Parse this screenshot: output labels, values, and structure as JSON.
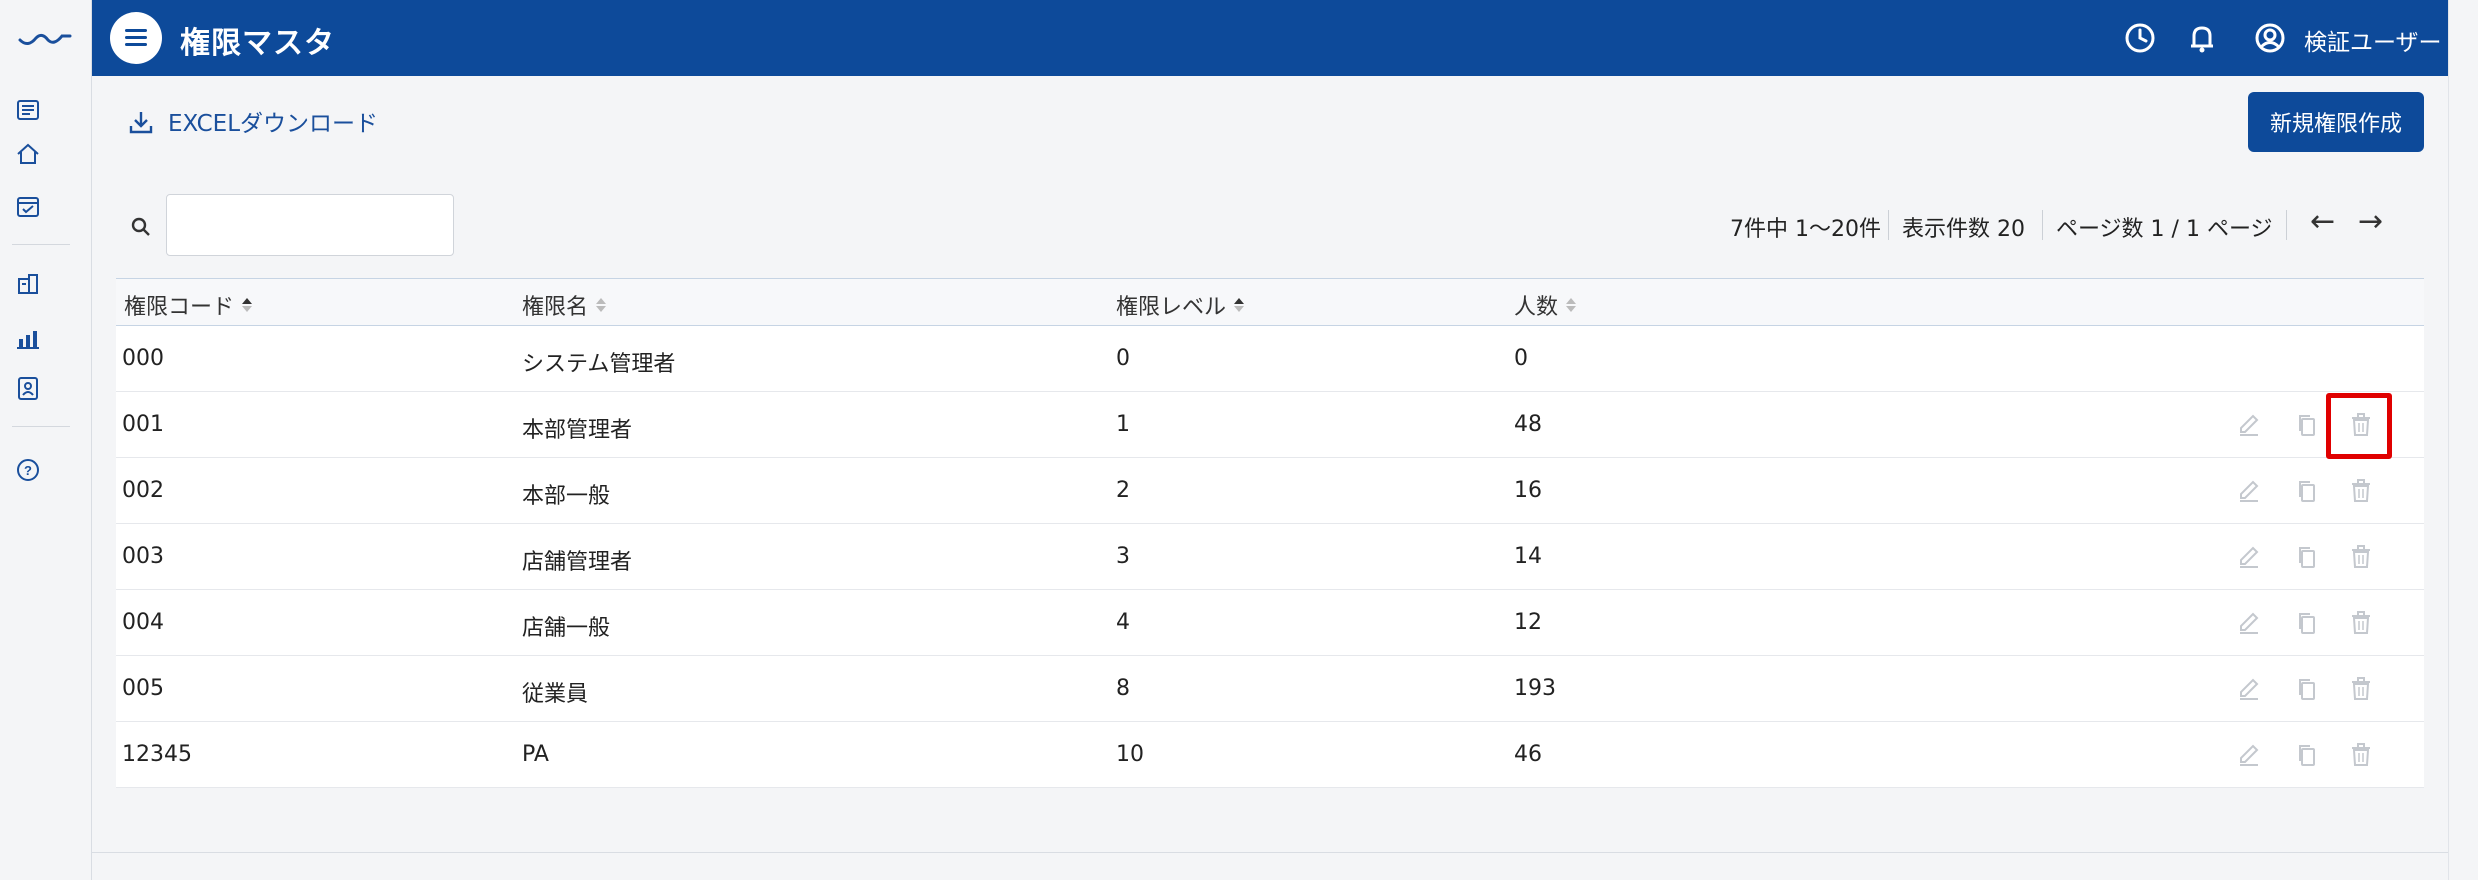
{
  "header": {
    "title": "権限マスタ",
    "user_name": "検証ユーザー",
    "icons": [
      "menu-icon",
      "clock-icon",
      "bell-icon",
      "user-circle-icon"
    ]
  },
  "sidebar": {
    "icons": [
      "list-icon",
      "home-icon",
      "calendar-check-icon",
      "building-icon",
      "bar-chart-icon",
      "id-badge-icon",
      "help-icon"
    ]
  },
  "toolbar": {
    "excel_label": "EXCELダウンロード",
    "new_button_label": "新規権限作成"
  },
  "search": {
    "value": "",
    "placeholder": ""
  },
  "pagination": {
    "range_text": "7件中 1〜20件",
    "per_page_text": "表示件数 20",
    "page_text": "ページ数 1 / 1 ページ",
    "prev_symbol": "←",
    "next_symbol": "→"
  },
  "table": {
    "columns": [
      "権限コード",
      "権限名",
      "権限レベル",
      "人数"
    ],
    "rows": [
      {
        "code": "000",
        "name": "システム管理者",
        "level": "0",
        "count": "0",
        "actions": false
      },
      {
        "code": "001",
        "name": "本部管理者",
        "level": "1",
        "count": "48",
        "actions": true
      },
      {
        "code": "002",
        "name": "本部一般",
        "level": "2",
        "count": "16",
        "actions": true
      },
      {
        "code": "003",
        "name": "店舗管理者",
        "level": "3",
        "count": "14",
        "actions": true
      },
      {
        "code": "004",
        "name": "店舗一般",
        "level": "4",
        "count": "12",
        "actions": true
      },
      {
        "code": "005",
        "name": "従業員",
        "level": "8",
        "count": "193",
        "actions": true
      },
      {
        "code": "12345",
        "name": "PA",
        "level": "10",
        "count": "46",
        "actions": true
      }
    ]
  },
  "colors": {
    "brand": "#0d4a9a",
    "highlight": "#e00000"
  }
}
